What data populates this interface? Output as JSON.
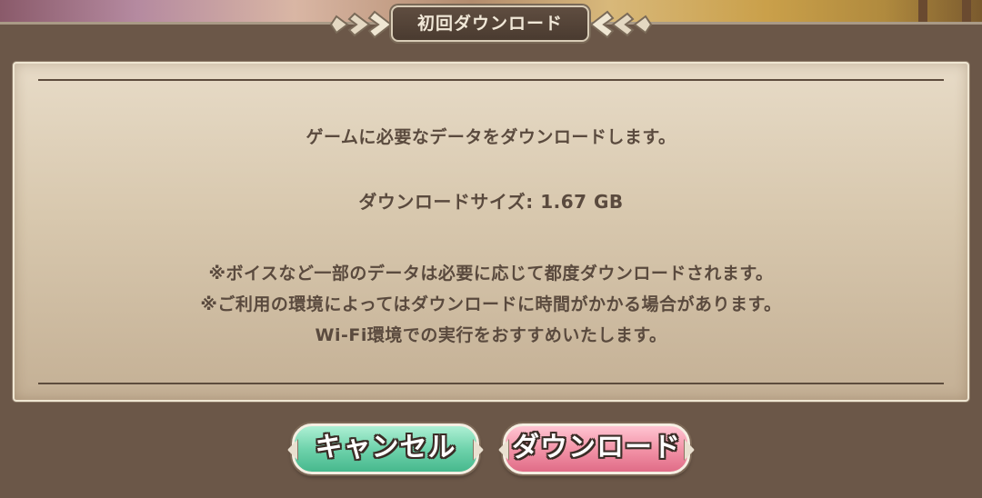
{
  "dialog": {
    "title": "初回ダウンロード",
    "message_main": "ゲームに必要なデータをダウンロードします。",
    "size_line": "ダウンロードサイズ: 1.67 GB",
    "notes": [
      "※ボイスなど一部のデータは必要に応じて都度ダウンロードされます。",
      "※ご利用の環境によってはダウンロードに時間がかかる場合があります。",
      "Wi-Fi環境での実行をおすすめいたします。"
    ]
  },
  "buttons": {
    "cancel_label": "キャンセル",
    "download_label": "ダウンロード"
  },
  "colors": {
    "frame": "#6b5748",
    "parchment": "#ddd0ba",
    "text": "#5a4a3e",
    "cancel_button": "#6fd3ac",
    "download_button": "#f394a8"
  },
  "icons": {
    "title_left": "ornament-wing-icon",
    "title_right": "ornament-wing-icon"
  }
}
